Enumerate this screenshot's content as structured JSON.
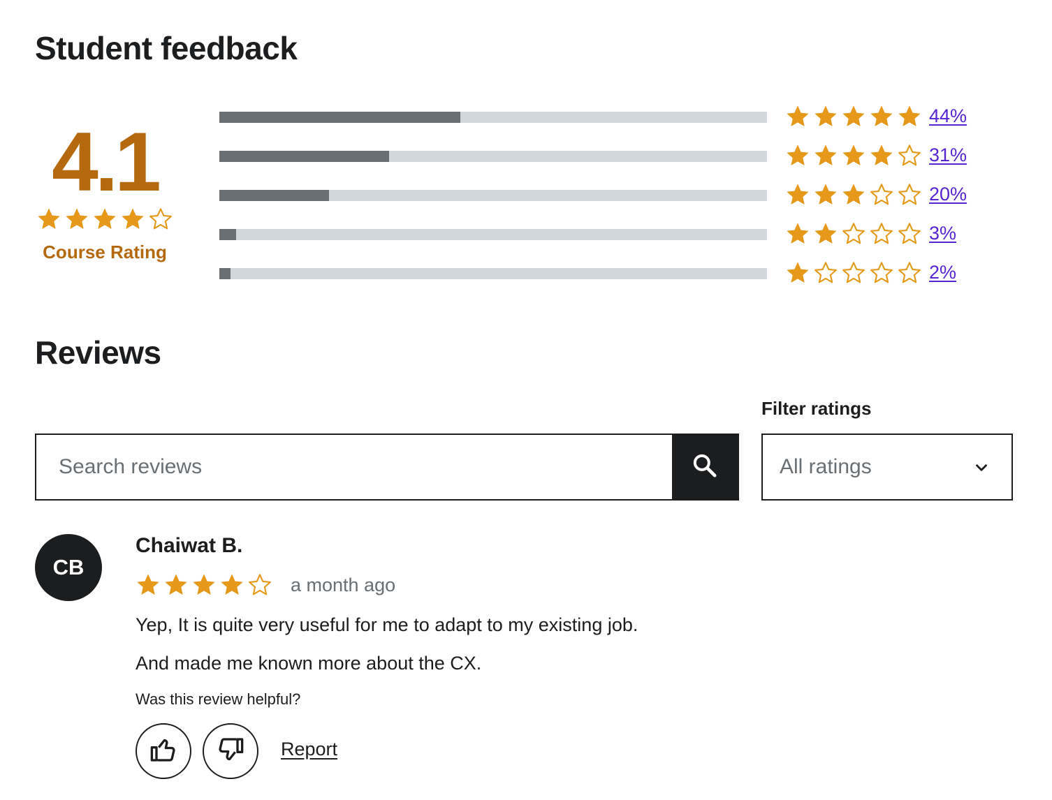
{
  "feedback": {
    "title": "Student feedback",
    "average": "4.1",
    "average_stars": 4,
    "label": "Course Rating",
    "star_color": "#e59819",
    "rating_color": "#b4690e",
    "breakdown": [
      {
        "stars": 5,
        "share": 0.44,
        "percent_label": "44%"
      },
      {
        "stars": 4,
        "share": 0.31,
        "percent_label": "31%"
      },
      {
        "stars": 3,
        "share": 0.2,
        "percent_label": "20%"
      },
      {
        "stars": 2,
        "share": 0.03,
        "percent_label": "3%"
      },
      {
        "stars": 1,
        "share": 0.02,
        "percent_label": "2%"
      }
    ]
  },
  "reviews": {
    "title": "Reviews",
    "search": {
      "placeholder": "Search reviews",
      "value": "",
      "icon": "search-icon"
    },
    "filter": {
      "label": "Filter ratings",
      "selected": "All ratings",
      "icon": "chevron-down-icon"
    },
    "items": [
      {
        "initials": "CB",
        "name": "Chaiwat B.",
        "stars": 4,
        "date": "a month ago",
        "lines": [
          "Yep, It is quite very useful for me to adapt to my existing job.",
          "And made me known more about the CX."
        ],
        "helpful_prompt": "Was this review helpful?",
        "report_label": "Report"
      }
    ]
  }
}
